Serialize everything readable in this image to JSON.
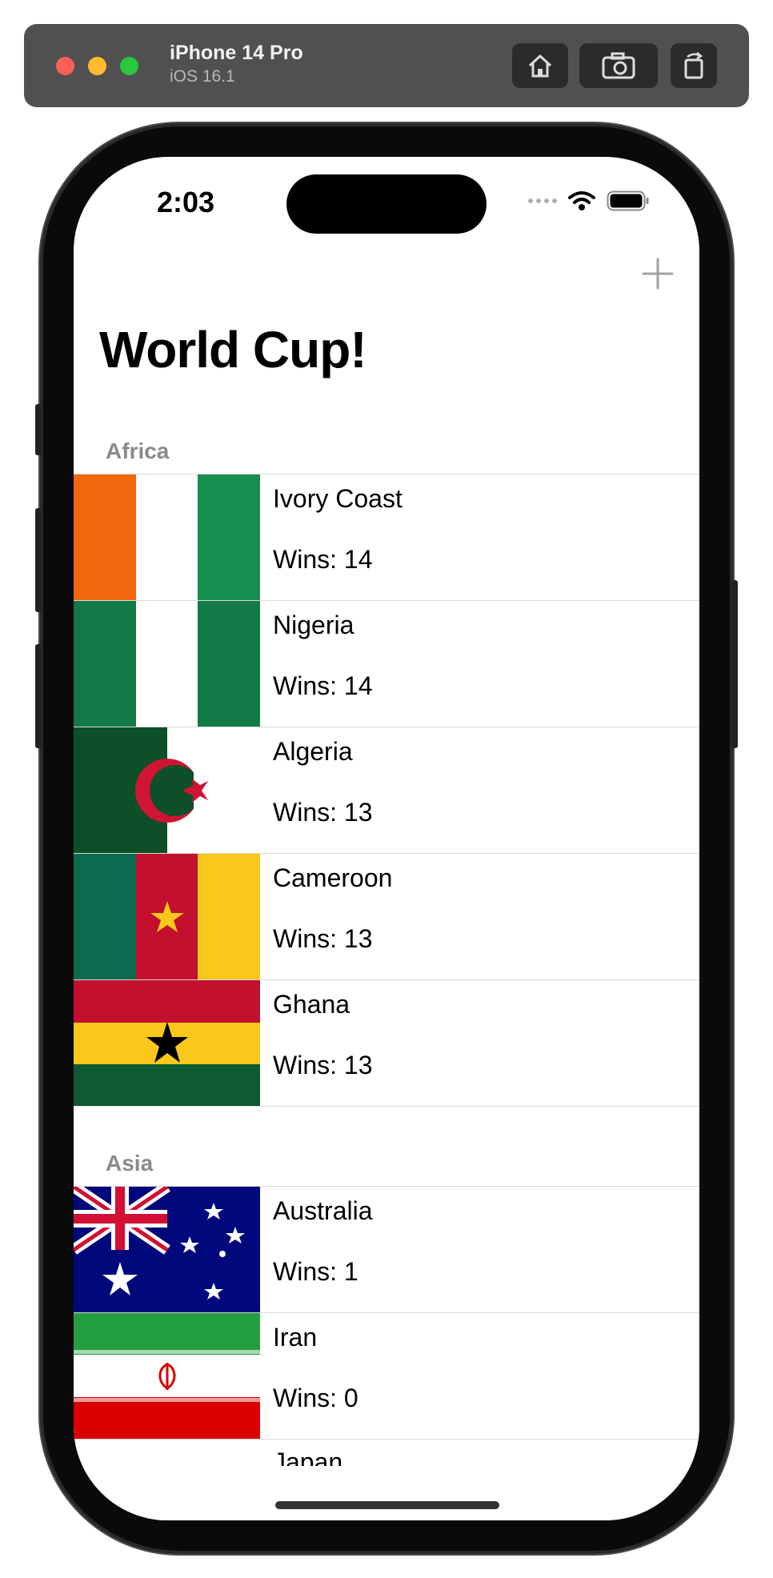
{
  "simulator": {
    "device_name": "iPhone 14 Pro",
    "os_version": "iOS 16.1",
    "buttons": [
      "home-icon",
      "screenshot-icon",
      "rotate-icon"
    ]
  },
  "status_bar": {
    "time": "2:03"
  },
  "nav": {
    "title": "World Cup!",
    "add_button": "+"
  },
  "sections": [
    {
      "title": "Africa",
      "rows": [
        {
          "country": "Ivory Coast",
          "wins": "Wins: 14"
        },
        {
          "country": "Nigeria",
          "wins": "Wins: 14"
        },
        {
          "country": "Algeria",
          "wins": "Wins: 13"
        },
        {
          "country": "Cameroon",
          "wins": "Wins: 13"
        },
        {
          "country": "Ghana",
          "wins": "Wins: 13"
        }
      ]
    },
    {
      "title": "Asia",
      "rows": [
        {
          "country": "Australia",
          "wins": "Wins: 1"
        },
        {
          "country": "Iran",
          "wins": "Wins: 0"
        },
        {
          "country": "Japan",
          "wins": ""
        }
      ]
    }
  ],
  "colors": {
    "toolbar": "#505050",
    "section_header": "#8a8a8e",
    "separator": "#d8d8d8",
    "add_button": "#a0a0a0"
  }
}
